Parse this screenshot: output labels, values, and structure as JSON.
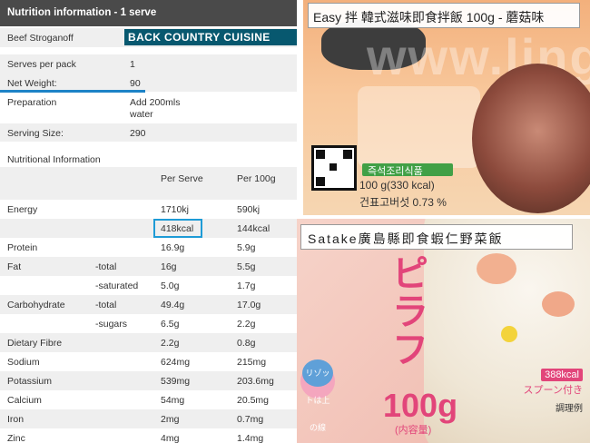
{
  "nutrition": {
    "header": "Nutrition information - 1 serve",
    "product": "Beef Stroganoff",
    "brand": "BACK COUNTRY CUISINE",
    "summary": [
      {
        "label": "Serves per pack",
        "value": "1"
      },
      {
        "label": "Net Weight:",
        "value": "90"
      }
    ],
    "preparation_label": "Preparation",
    "preparation_line1": "Add 200mls",
    "preparation_line2": "water",
    "serving_size_label": "Serving Size:",
    "serving_size_value": "290",
    "section_title": "Nutritional Information",
    "col_per_serve": "Per Serve",
    "col_per_100g": "Per 100g",
    "rows": [
      {
        "name": "Energy",
        "sub": "",
        "serve": "1710kj",
        "g100": "590kj"
      },
      {
        "name": "",
        "sub": "",
        "serve": "418kcal",
        "g100": "144kcal"
      },
      {
        "name": "Protein",
        "sub": "",
        "serve": "16.9g",
        "g100": "5.9g"
      },
      {
        "name": "Fat",
        "sub": "-total",
        "serve": "16g",
        "g100": "5.5g"
      },
      {
        "name": "",
        "sub": "-saturated",
        "serve": "5.0g",
        "g100": "1.7g"
      },
      {
        "name": "Carbohydrate",
        "sub": "-total",
        "serve": "49.4g",
        "g100": "17.0g"
      },
      {
        "name": "",
        "sub": "-sugars",
        "serve": "6.5g",
        "g100": "2.2g"
      },
      {
        "name": "Dietary Fibre",
        "sub": "",
        "serve": "2.2g",
        "g100": "0.8g"
      },
      {
        "name": "Sodium",
        "sub": "",
        "serve": "624mg",
        "g100": "215mg"
      },
      {
        "name": "Potassium",
        "sub": "",
        "serve": "539mg",
        "g100": "203.6mg"
      },
      {
        "name": "Calcium",
        "sub": "",
        "serve": "54mg",
        "g100": "20.5mg"
      },
      {
        "name": "Iron",
        "sub": "",
        "serve": "2mg",
        "g100": "0.7mg"
      },
      {
        "name": "Zinc",
        "sub": "",
        "serve": "4mg",
        "g100": "1.4mg"
      }
    ]
  },
  "photo_top": {
    "caption": "Easy 拌 韓式滋味即食拌飯 100g - 蘑菇味",
    "label_green": "즉석조리식품",
    "weight": "100 g(330 kcal)",
    "sub": "건표고버섯  0.73 %",
    "watermark": "www.lings"
  },
  "photo_bottom": {
    "caption": "Satake廣島縣即食蝦仁野菜飯",
    "katakana": "ピラフ",
    "weight": "100g",
    "weight_sub": "(内容量)",
    "badge": "リゾットは上の線",
    "kcal": "388kcal",
    "spoon": "スプーン付き",
    "example": "調理例"
  }
}
